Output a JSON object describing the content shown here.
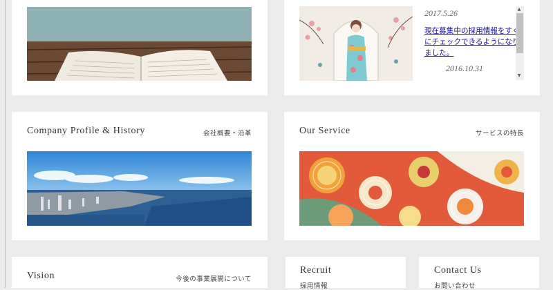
{
  "news": {
    "date1": "2017.5.26",
    "link1": "現在募集中の採用情報をすぐにチェックできるようになりました。",
    "date2": "2016.10.31",
    "scroll_up_icon": "triangle-up",
    "scroll_down_icon": "triangle-down"
  },
  "company": {
    "title": "Company Profile & History",
    "subtitle": "会社概要・沿革"
  },
  "service": {
    "title": "Our Service",
    "subtitle": "サービスの特長"
  },
  "vision": {
    "title": "Vision",
    "subtitle": "今後の事業展開について"
  },
  "recruit": {
    "title": "Recruit",
    "subtitle": "採用情報"
  },
  "contact": {
    "title": "Contact Us",
    "subtitle": "お問い合わせ"
  }
}
